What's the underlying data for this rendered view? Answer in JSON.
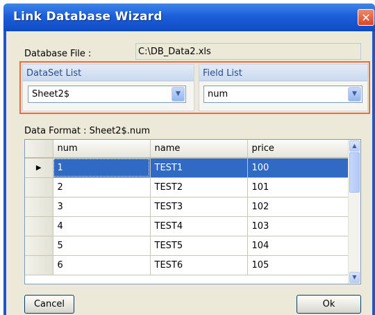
{
  "window": {
    "title": "Link Database Wizard",
    "close_glyph": "✕"
  },
  "database_file": {
    "label": "Database File :",
    "value": "C:\\DB_Data2.xls"
  },
  "dataset_list": {
    "label": "DataSet List",
    "selected": "Sheet2$"
  },
  "field_list": {
    "label": "Field List",
    "selected": "num"
  },
  "data_format": {
    "label": "Data Format : Sheet2$.num"
  },
  "grid": {
    "columns": [
      "num",
      "name",
      "price"
    ],
    "rows": [
      {
        "num": "1",
        "name": "TEST1",
        "price": "100"
      },
      {
        "num": "2",
        "name": "TEST2",
        "price": "101"
      },
      {
        "num": "3",
        "name": "TEST3",
        "price": "102"
      },
      {
        "num": "4",
        "name": "TEST4",
        "price": "103"
      },
      {
        "num": "5",
        "name": "TEST5",
        "price": "104"
      },
      {
        "num": "6",
        "name": "TEST6",
        "price": "105"
      }
    ],
    "selected_row": 1,
    "row_indicator_glyph": "▶"
  },
  "icons": {
    "dropdown": "chevron-down-icon",
    "scroll_up": "arrow-up-icon",
    "scroll_down": "arrow-down-icon"
  },
  "buttons": {
    "cancel_label": "Cancel",
    "ok_label": "Ok"
  },
  "colors": {
    "titlebar": "#1d5fd9",
    "selection": "#316ac5",
    "highlight_border": "#f26a3a",
    "dialog_bg": "#ece9d8"
  }
}
